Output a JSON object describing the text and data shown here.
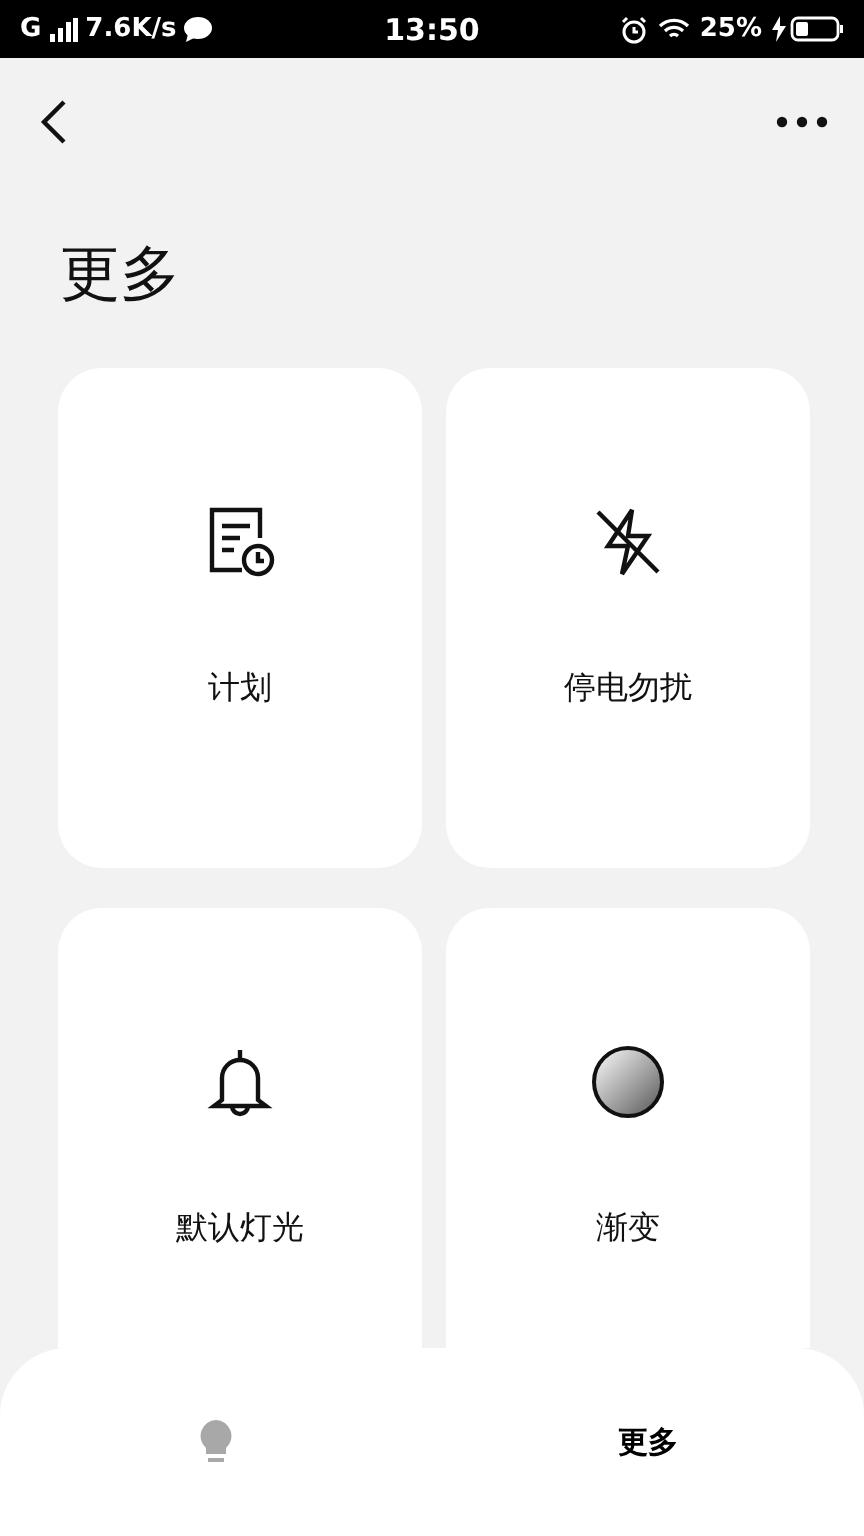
{
  "status_bar": {
    "network": "G",
    "speed": "7.6K/s",
    "time": "13:50",
    "battery": "25%"
  },
  "header": {
    "title": "更多"
  },
  "cards": [
    {
      "kind": "schedule",
      "label": "计划"
    },
    {
      "kind": "flash-off",
      "label": "停电勿扰"
    },
    {
      "kind": "bell",
      "label": "默认灯光"
    },
    {
      "kind": "gradient",
      "label": "渐变"
    }
  ],
  "bottom_nav": [
    {
      "kind": "bulb",
      "selected": false
    },
    {
      "kind": "text",
      "label": "更多",
      "selected": true
    }
  ]
}
